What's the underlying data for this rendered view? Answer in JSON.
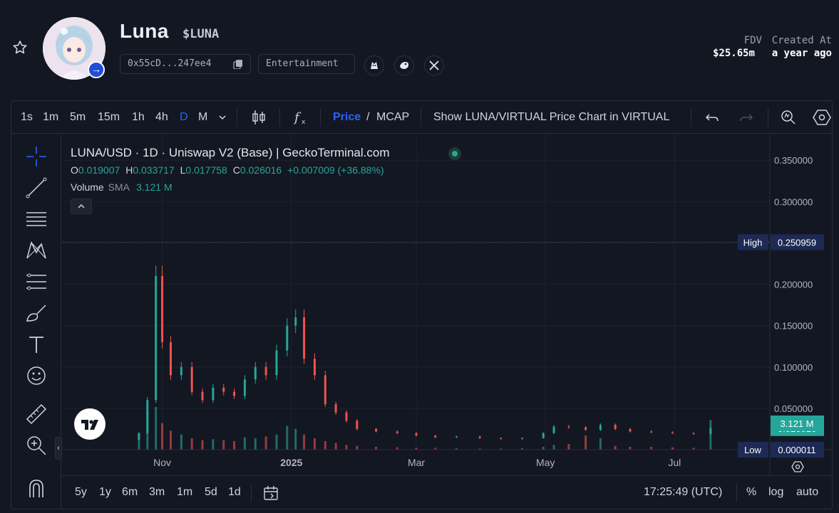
{
  "token": {
    "name": "Luna",
    "ticker": "$LUNA",
    "address": "0x55cD...247ee4",
    "category": "Entertainment",
    "socials": [
      "coingecko-icon",
      "geckoterminal-icon",
      "x-icon"
    ],
    "stats": {
      "fdv_label": "FDV",
      "fdv_value": "$25.65m",
      "created_label": "Created At",
      "created_value": "a year ago"
    }
  },
  "toolbar": {
    "timeframes": [
      "1s",
      "1m",
      "5m",
      "15m",
      "1h",
      "4h",
      "D",
      "M"
    ],
    "active_timeframe": "D",
    "price_label": "Price",
    "mcap_label": "MCAP",
    "pair_toggle_label": "Show LUNA/VIRTUAL Price Chart in VIRTUAL"
  },
  "legend": {
    "title": "LUNA/USD · 1D · Uniswap V2 (Base) | GeckoTerminal.com",
    "o_label": "O",
    "o_value": "0.019007",
    "h_label": "H",
    "h_value": "0.033717",
    "l_label": "L",
    "l_value": "0.017758",
    "c_label": "C",
    "c_value": "0.026016",
    "change": "+0.007009 (+36.88%)",
    "volume_label": "Volume",
    "sma_label": "SMA",
    "volume_value": "3.121 M"
  },
  "bottombar": {
    "ranges": [
      "5y",
      "1y",
      "6m",
      "3m",
      "1m",
      "5d",
      "1d"
    ],
    "time": "17:25:49 (UTC)",
    "percent_label": "%",
    "log_label": "log",
    "auto_label": "auto"
  },
  "colors": {
    "up": "#26a69a",
    "down": "#ef5350",
    "accent": "#2962ff",
    "background": "#131722",
    "marker_bg": "#1e2a55"
  },
  "chart_data": {
    "type": "candlestick",
    "title": "LUNA/USD · 1D · Uniswap V2 (Base) | GeckoTerminal.com",
    "y_ticks": [
      "0.350000",
      "0.300000",
      "0.250000",
      "0.200000",
      "0.150000",
      "0.100000",
      "0.050000"
    ],
    "x_ticks": [
      "Nov",
      "2025",
      "Mar",
      "May",
      "Jul"
    ],
    "x_tick_dates": [
      "2024-11-01",
      "2025-01-01",
      "2025-03-01",
      "2025-05-01",
      "2025-07-01"
    ],
    "ylim": [
      0,
      0.37
    ],
    "xlim": [
      "2024-09-15",
      "2025-08-15"
    ],
    "high_label": "High",
    "high_value": 0.250959,
    "low_label": "Low",
    "low_value": 1.1e-05,
    "last_price": 0.026016,
    "last_price_label": "0.026016",
    "last_volume_label": "3.121 M",
    "grid": true,
    "price_series": {
      "name": "LUNA/USD",
      "dates": [
        "2024-10-21",
        "2024-10-25",
        "2024-10-29",
        "2024-11-01",
        "2024-11-05",
        "2024-11-10",
        "2024-11-15",
        "2024-11-20",
        "2024-11-25",
        "2024-11-30",
        "2024-12-05",
        "2024-12-10",
        "2024-12-15",
        "2024-12-20",
        "2024-12-25",
        "2024-12-30",
        "2025-01-03",
        "2025-01-07",
        "2025-01-12",
        "2025-01-17",
        "2025-01-22",
        "2025-01-27",
        "2025-02-01",
        "2025-02-10",
        "2025-02-20",
        "2025-03-01",
        "2025-03-10",
        "2025-03-20",
        "2025-03-31",
        "2025-04-10",
        "2025-04-20",
        "2025-04-30",
        "2025-05-05",
        "2025-05-12",
        "2025-05-20",
        "2025-05-27",
        "2025-06-03",
        "2025-06-10",
        "2025-06-20",
        "2025-06-30",
        "2025-07-10",
        "2025-07-18"
      ],
      "close": [
        0.02,
        0.06,
        0.21,
        0.13,
        0.09,
        0.1,
        0.07,
        0.06,
        0.075,
        0.07,
        0.065,
        0.085,
        0.1,
        0.09,
        0.12,
        0.15,
        0.16,
        0.11,
        0.09,
        0.055,
        0.045,
        0.035,
        0.025,
        0.022,
        0.02,
        0.017,
        0.015,
        0.016,
        0.014,
        0.013,
        0.014,
        0.02,
        0.028,
        0.027,
        0.024,
        0.03,
        0.025,
        0.022,
        0.021,
        0.02,
        0.019,
        0.026
      ]
    },
    "volume_series": {
      "name": "Volume",
      "dates": [
        "2024-10-21",
        "2024-10-25",
        "2024-10-29",
        "2024-11-01",
        "2024-11-05",
        "2024-11-10",
        "2024-11-15",
        "2024-11-20",
        "2024-11-25",
        "2024-11-30",
        "2024-12-05",
        "2024-12-10",
        "2024-12-15",
        "2024-12-20",
        "2024-12-25",
        "2024-12-30",
        "2025-01-03",
        "2025-01-07",
        "2025-01-12",
        "2025-01-17",
        "2025-01-22",
        "2025-01-27",
        "2025-02-01",
        "2025-02-10",
        "2025-02-20",
        "2025-03-01",
        "2025-03-10",
        "2025-03-20",
        "2025-03-31",
        "2025-04-10",
        "2025-04-20",
        "2025-04-30",
        "2025-05-05",
        "2025-05-12",
        "2025-05-20",
        "2025-05-27",
        "2025-06-03",
        "2025-06-10",
        "2025-06-20",
        "2025-06-30",
        "2025-07-10",
        "2025-07-18"
      ],
      "values": [
        1.5,
        4.0,
        4.5,
        2.8,
        2.0,
        1.6,
        1.2,
        1.0,
        1.1,
        1.0,
        0.9,
        1.3,
        1.2,
        1.4,
        1.6,
        2.5,
        2.2,
        1.6,
        1.2,
        0.9,
        0.7,
        0.5,
        0.4,
        0.3,
        0.25,
        0.2,
        0.2,
        0.15,
        0.12,
        0.12,
        0.15,
        0.3,
        0.5,
        0.6,
        1.5,
        1.2,
        0.4,
        0.3,
        0.3,
        0.25,
        0.2,
        3.121
      ],
      "unit": "M"
    }
  }
}
